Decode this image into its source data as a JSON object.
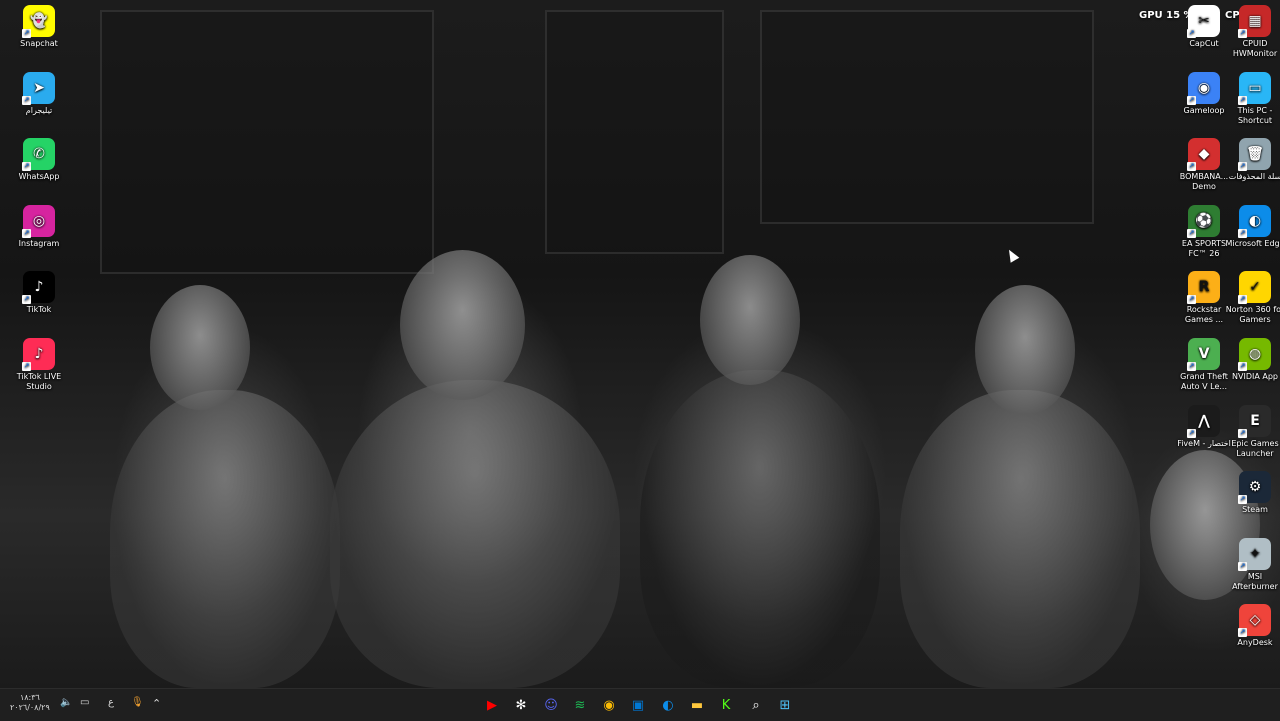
{
  "overlay": {
    "gpu_label": "GPU",
    "gpu_value": "15 %",
    "cpu_label": "CPU"
  },
  "desktop_left": [
    {
      "label": "Snapchat",
      "icon": "snapchat-icon",
      "color": "#FFFC00"
    },
    {
      "label": "تيليجرام",
      "icon": "telegram-icon",
      "color": "#2AABEE"
    },
    {
      "label": "WhatsApp",
      "icon": "whatsapp-icon",
      "color": "#25D366"
    },
    {
      "label": "Instagram",
      "icon": "instagram-icon",
      "color": "#D6249F"
    },
    {
      "label": "TikTok",
      "icon": "tiktok-icon",
      "color": "#000000"
    },
    {
      "label": "TikTok LIVE Studio",
      "icon": "tiktok-live-studio-icon",
      "color": "#FE2C55"
    }
  ],
  "desktop_right_col1": [
    {
      "label": "CapCut",
      "icon": "capcut-icon",
      "color": "#FFFFFF"
    },
    {
      "label": "Gameloop",
      "icon": "gameloop-icon",
      "color": "#3B82F6"
    },
    {
      "label": "BOMBANA... Demo",
      "icon": "bombana-demo-icon",
      "color": "#D32F2F"
    },
    {
      "label": "EA SPORTS FC™ 26",
      "icon": "ea-sports-fc-icon",
      "color": "#2E7D32"
    },
    {
      "label": "Rockstar Games ...",
      "icon": "rockstar-games-icon",
      "color": "#FCAF17"
    },
    {
      "label": "Grand Theft Auto V Le...",
      "icon": "gta-v-icon",
      "color": "#4CAF50"
    },
    {
      "label": "FiveM - اختصار",
      "icon": "fivem-icon",
      "color": "#1B1B1B"
    }
  ],
  "desktop_right_col2": [
    {
      "label": "CPUID HWMonitor",
      "icon": "hwmonitor-icon",
      "color": "#C62828"
    },
    {
      "label": "This PC - Shortcut",
      "icon": "this-pc-icon",
      "color": "#29B6F6"
    },
    {
      "label": "سلة المحذوفات",
      "icon": "recycle-bin-icon",
      "color": "#90A4AE"
    },
    {
      "label": "Microsoft Edge",
      "icon": "edge-icon",
      "color": "#0C8CE9"
    },
    {
      "label": "Norton 360 for Gamers",
      "icon": "norton-icon",
      "color": "#FFD600"
    },
    {
      "label": "NVIDIA App",
      "icon": "nvidia-icon",
      "color": "#76B900"
    },
    {
      "label": "Epic Games Launcher",
      "icon": "epic-games-icon",
      "color": "#2A2A2A"
    },
    {
      "label": "Steam",
      "icon": "steam-icon",
      "color": "#1B2838"
    },
    {
      "label": "MSI Afterburner",
      "icon": "msi-afterburner-icon",
      "color": "#B0BEC5"
    },
    {
      "label": "AnyDesk",
      "icon": "anydesk-icon",
      "color": "#EF443B"
    }
  ],
  "taskbar": {
    "apps": [
      {
        "name": "youtube-icon",
        "color": "#FF0000"
      },
      {
        "name": "chatgpt-icon",
        "color": "#FFFFFF"
      },
      {
        "name": "discord-icon",
        "color": "#5865F2"
      },
      {
        "name": "spotify-icon",
        "color": "#1DB954"
      },
      {
        "name": "chrome-icon",
        "color": "#FBBC05"
      },
      {
        "name": "microsoft-store-icon",
        "color": "#0078D4"
      },
      {
        "name": "edge-icon",
        "color": "#0C8CE9"
      },
      {
        "name": "file-explorer-icon",
        "color": "#FFC83D"
      },
      {
        "name": "kick-icon",
        "color": "#53FC18"
      },
      {
        "name": "search-icon",
        "color": "#FFFFFF"
      },
      {
        "name": "start-icon",
        "color": "#4FC3F7"
      }
    ],
    "tray": {
      "clock_time": "١٨:٣٦",
      "clock_date": "٢٠٢٦/٠٨/٢٩",
      "language": "ع"
    }
  }
}
